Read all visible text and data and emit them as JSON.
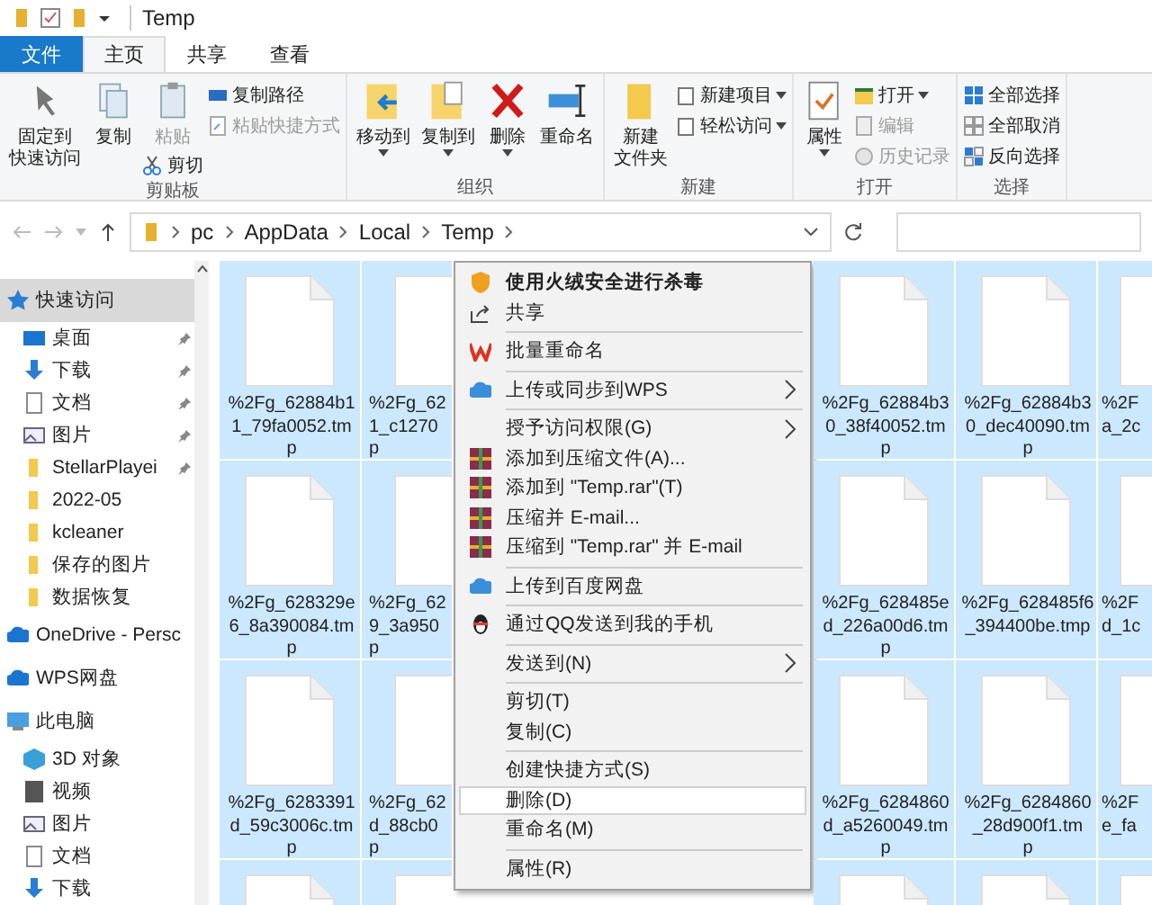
{
  "window": {
    "title": "Temp"
  },
  "tabs": [
    {
      "label": "文件",
      "kind": "file",
      "selected": false
    },
    {
      "label": "主页",
      "kind": "tab",
      "selected": true
    },
    {
      "label": "共享",
      "kind": "tab",
      "selected": false
    },
    {
      "label": "查看",
      "kind": "tab",
      "selected": false
    }
  ],
  "ribbon": {
    "groups": [
      {
        "label": "剪贴板",
        "items": [
          {
            "kind": "large",
            "lines": [
              "固定到",
              "快速访问"
            ],
            "disabled": false,
            "dropdown": false
          },
          {
            "kind": "large",
            "lines": [
              "复制"
            ],
            "disabled": false,
            "dropdown": false
          },
          {
            "kind": "paste",
            "lines": [
              "粘贴"
            ],
            "disabled": true,
            "dropdown": false
          },
          {
            "kind": "cut",
            "lines": [
              "剪切"
            ],
            "disabled": false,
            "dropdown": false
          },
          {
            "kind": "small",
            "lines": [
              "复制路径"
            ],
            "disabled": false,
            "dropdown": false
          },
          {
            "kind": "small",
            "lines": [
              "粘贴快捷方式"
            ],
            "disabled": true,
            "dropdown": false
          }
        ]
      },
      {
        "label": "组织",
        "items": [
          {
            "kind": "large",
            "lines": [
              "移动到"
            ],
            "disabled": false,
            "dropdown": true
          },
          {
            "kind": "large",
            "lines": [
              "复制到"
            ],
            "disabled": false,
            "dropdown": true
          },
          {
            "kind": "large",
            "lines": [
              "删除"
            ],
            "disabled": false,
            "dropdown": true
          },
          {
            "kind": "large",
            "lines": [
              "重命名"
            ],
            "disabled": false,
            "dropdown": false
          }
        ]
      },
      {
        "label": "新建",
        "items": [
          {
            "kind": "large",
            "lines": [
              "新建",
              "文件夹"
            ],
            "disabled": false,
            "dropdown": false
          },
          {
            "kind": "small",
            "lines": [
              "新建项目"
            ],
            "disabled": false,
            "dropdown": true
          },
          {
            "kind": "small",
            "lines": [
              "轻松访问"
            ],
            "disabled": false,
            "dropdown": true
          }
        ]
      },
      {
        "label": "打开",
        "items": [
          {
            "kind": "large",
            "lines": [
              "属性"
            ],
            "disabled": false,
            "dropdown": true
          },
          {
            "kind": "small",
            "lines": [
              "打开"
            ],
            "disabled": false,
            "dropdown": true
          },
          {
            "kind": "small",
            "lines": [
              "编辑"
            ],
            "disabled": true,
            "dropdown": false
          },
          {
            "kind": "small",
            "lines": [
              "历史记录"
            ],
            "disabled": true,
            "dropdown": false
          }
        ]
      },
      {
        "label": "选择",
        "items": [
          {
            "kind": "small",
            "lines": [
              "全部选择"
            ],
            "disabled": false,
            "dropdown": false
          },
          {
            "kind": "small",
            "lines": [
              "全部取消"
            ],
            "disabled": false,
            "dropdown": false
          },
          {
            "kind": "small",
            "lines": [
              "反向选择"
            ],
            "disabled": false,
            "dropdown": false
          }
        ]
      }
    ]
  },
  "address": {
    "crumbs": [
      "pc",
      "AppData",
      "Local",
      "Temp"
    ]
  },
  "sidebar": {
    "items": [
      {
        "label": "快速访问",
        "selected": true,
        "children": [
          {
            "label": "桌面",
            "selected": false,
            "pinned": true
          },
          {
            "label": "下载",
            "selected": false,
            "pinned": true
          },
          {
            "label": "文档",
            "selected": false,
            "pinned": true
          },
          {
            "label": "图片",
            "selected": false,
            "pinned": true
          },
          {
            "label": "StellarPlayei",
            "selected": false,
            "pinned": true
          },
          {
            "label": "2022-05",
            "selected": false,
            "pinned": false
          },
          {
            "label": "kcleaner",
            "selected": false,
            "pinned": false
          },
          {
            "label": "保存的图片",
            "selected": false,
            "pinned": false
          },
          {
            "label": "数据恢复",
            "selected": false,
            "pinned": false
          }
        ]
      },
      {
        "label": "OneDrive - Persc",
        "selected": false
      },
      {
        "label": "WPS网盘",
        "selected": false
      },
      {
        "label": "此电脑",
        "selected": false,
        "children": [
          {
            "label": "3D 对象",
            "selected": false,
            "pinned": false
          },
          {
            "label": "视频",
            "selected": false,
            "pinned": false
          },
          {
            "label": "图片",
            "selected": false,
            "pinned": false
          },
          {
            "label": "文档",
            "selected": false,
            "pinned": false
          },
          {
            "label": "下载",
            "selected": false,
            "pinned": false
          }
        ]
      }
    ]
  },
  "file_columns": [
    {
      "kind": "full",
      "files": [
        {
          "lines": [
            "%2Fg_62884b1",
            "1_79fa0052.tm",
            "p"
          ],
          "selected": true
        },
        {
          "lines": [
            "%2Fg_628329e",
            "6_8a390084.tm",
            "p"
          ],
          "selected": true
        },
        {
          "lines": [
            "%2Fg_6283391",
            "d_59c3006c.tm",
            "p"
          ],
          "selected": true
        },
        {
          "selected": true
        }
      ]
    },
    {
      "kind": "clipped",
      "files": [
        {
          "lines": [
            "%2Fg_62",
            "1_c1270",
            "p"
          ],
          "selected": true
        },
        {
          "lines": [
            "%2Fg_62",
            "9_3a950",
            "p"
          ],
          "selected": true
        },
        {
          "lines": [
            "%2Fg_62",
            "d_88cb0",
            "p"
          ],
          "selected": true
        },
        {
          "selected": true
        }
      ]
    },
    {
      "kind": "menu"
    },
    {
      "kind": "full",
      "files": [
        {
          "lines": [
            "%2Fg_62884b3",
            "0_38f40052.tm",
            "p"
          ],
          "selected": true
        },
        {
          "lines": [
            "%2Fg_628485e",
            "d_226a00d6.tm",
            "p"
          ],
          "selected": true
        },
        {
          "lines": [
            "%2Fg_6284860",
            "d_a5260049.tm",
            "p"
          ],
          "selected": true
        },
        {
          "selected": true
        }
      ]
    },
    {
      "kind": "full",
      "files": [
        {
          "lines": [
            "%2Fg_62884b3",
            "0_dec40090.tm",
            "p"
          ],
          "selected": true
        },
        {
          "lines": [
            "%2Fg_628485f6",
            "_394400be.tmp"
          ],
          "selected": true
        },
        {
          "lines": [
            "%2Fg_6284860",
            "_28d900f1.tm",
            "p"
          ],
          "selected": true
        },
        {
          "selected": true
        }
      ]
    },
    {
      "kind": "edge",
      "files": [
        {
          "lines": [
            "%2F",
            "a_2c"
          ],
          "selected": true
        },
        {
          "lines": [
            "%2F",
            "d_1c"
          ],
          "selected": true
        },
        {
          "lines": [
            "%2F",
            "e_fa"
          ],
          "selected": true
        },
        {
          "selected": true
        }
      ]
    }
  ],
  "context_menu": {
    "items": [
      {
        "kind": "item",
        "label": "使用火绒安全进行杀毒",
        "bold": true,
        "submenu": false,
        "selected": false
      },
      {
        "kind": "item",
        "label": "共享",
        "bold": false,
        "submenu": false,
        "selected": false
      },
      {
        "kind": "separator"
      },
      {
        "kind": "item",
        "label": "批量重命名",
        "bold": false,
        "submenu": false,
        "selected": false
      },
      {
        "kind": "separator"
      },
      {
        "kind": "item",
        "label": "上传或同步到WPS",
        "bold": false,
        "submenu": true,
        "selected": false
      },
      {
        "kind": "separator"
      },
      {
        "kind": "item",
        "label": "授予访问权限(G)",
        "bold": false,
        "submenu": true,
        "selected": false
      },
      {
        "kind": "item",
        "label": "添加到压缩文件(A)...",
        "bold": false,
        "submenu": false,
        "selected": false
      },
      {
        "kind": "item",
        "label": "添加到 \"Temp.rar\"(T)",
        "bold": false,
        "submenu": false,
        "selected": false
      },
      {
        "kind": "item",
        "label": "压缩并 E-mail...",
        "bold": false,
        "submenu": false,
        "selected": false
      },
      {
        "kind": "item",
        "label": "压缩到 \"Temp.rar\" 并 E-mail",
        "bold": false,
        "submenu": false,
        "selected": false
      },
      {
        "kind": "separator"
      },
      {
        "kind": "item",
        "label": "上传到百度网盘",
        "bold": false,
        "submenu": false,
        "selected": false
      },
      {
        "kind": "separator"
      },
      {
        "kind": "item",
        "label": "通过QQ发送到我的手机",
        "bold": false,
        "submenu": false,
        "selected": false
      },
      {
        "kind": "separator"
      },
      {
        "kind": "item",
        "label": "发送到(N)",
        "bold": false,
        "submenu": true,
        "selected": false
      },
      {
        "kind": "separator"
      },
      {
        "kind": "item",
        "label": "剪切(T)",
        "bold": false,
        "submenu": false,
        "selected": false
      },
      {
        "kind": "item",
        "label": "复制(C)",
        "bold": false,
        "submenu": false,
        "selected": false
      },
      {
        "kind": "separator"
      },
      {
        "kind": "item",
        "label": "创建快捷方式(S)",
        "bold": false,
        "submenu": false,
        "selected": false
      },
      {
        "kind": "item",
        "label": "删除(D)",
        "bold": false,
        "submenu": false,
        "selected": true
      },
      {
        "kind": "item",
        "label": "重命名(M)",
        "bold": false,
        "submenu": false,
        "selected": false
      },
      {
        "kind": "separator"
      },
      {
        "kind": "item",
        "label": "属性(R)",
        "bold": false,
        "submenu": false,
        "selected": false
      }
    ]
  }
}
